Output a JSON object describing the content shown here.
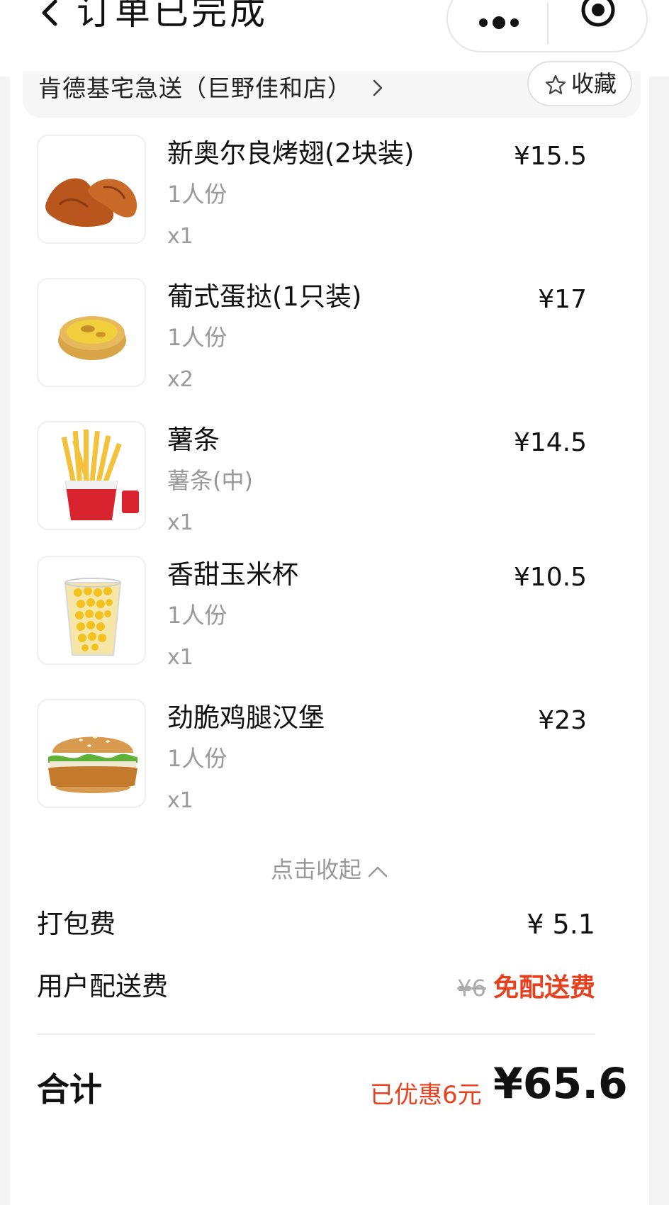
{
  "header": {
    "title": "订单已完成"
  },
  "store": {
    "name": "肯德基宅急送（巨野佳和店）",
    "favorite_label": "收藏"
  },
  "items": [
    {
      "name": "新奥尔良烤翅(2块装)",
      "spec": "1人份",
      "qty": "x1",
      "price": "¥15.5",
      "icon": "chicken-wings"
    },
    {
      "name": "葡式蛋挞(1只装)",
      "spec": "1人份",
      "qty": "x2",
      "price": "¥17",
      "icon": "egg-tart"
    },
    {
      "name": "薯条",
      "spec": "薯条(中)",
      "qty": "x1",
      "price": "¥14.5",
      "icon": "french-fries"
    },
    {
      "name": "香甜玉米杯",
      "spec": "1人份",
      "qty": "x1",
      "price": "¥10.5",
      "icon": "corn-cup"
    },
    {
      "name": "劲脆鸡腿汉堡",
      "spec": "1人份",
      "qty": "x1",
      "price": "¥23",
      "icon": "chicken-burger"
    }
  ],
  "collapse_label": "点击收起",
  "fees": {
    "packing": {
      "label": "打包费",
      "value": "¥ 5.1"
    },
    "delivery": {
      "label": "用户配送费",
      "original": "¥6",
      "free_label": "免配送费"
    }
  },
  "total": {
    "label": "合计",
    "saved": "已优惠6元",
    "amount": "¥65.6"
  },
  "colors": {
    "accent_red": "#e8401d",
    "muted": "#999999"
  }
}
